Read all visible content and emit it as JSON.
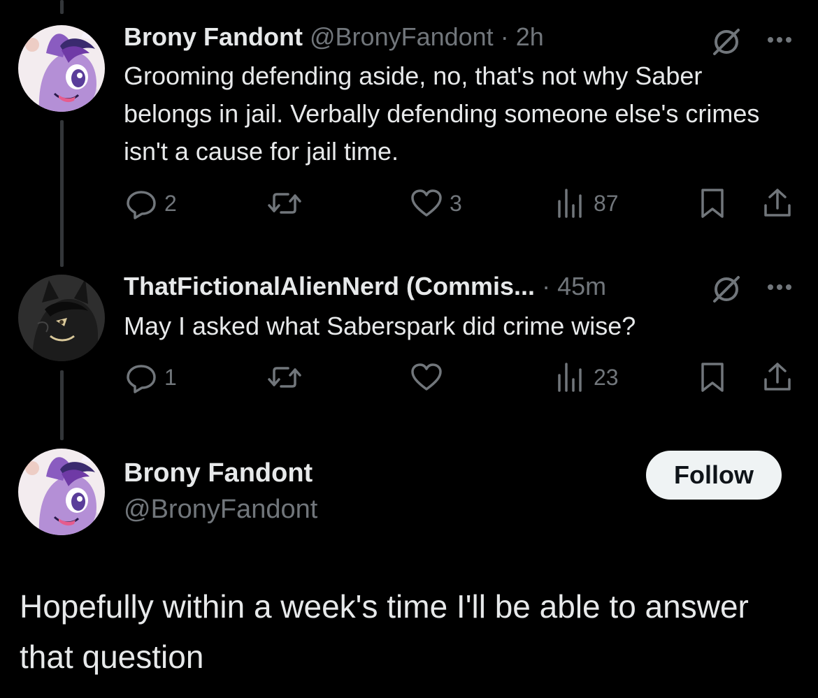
{
  "colors": {
    "background": "#000000",
    "text_primary": "#e7e9ea",
    "text_secondary": "#71767b",
    "thread_line": "#333639",
    "follow_button_bg": "#eff3f4",
    "follow_button_text": "#0f1419"
  },
  "reply1": {
    "author_name": "Brony Fandont",
    "author_handle": "@BronyFandont",
    "separator": "·",
    "time": "2h",
    "body": "Grooming defending aside, no, that's not why Saber belongs in jail. Verbally defending someone else's crimes isn't a cause for jail time.",
    "avatar_icon": "pony-avatar-icon",
    "actions": {
      "replies": "2",
      "reposts": "",
      "likes": "3",
      "views": "87"
    }
  },
  "reply2": {
    "author_name": "ThatFictionalAlienNerd (Commis...",
    "separator": "·",
    "time": "45m",
    "body": "May I asked what Saberspark did crime wise?",
    "avatar_icon": "dark-character-avatar-icon",
    "actions": {
      "replies": "1",
      "reposts": "",
      "likes": "",
      "views": "23"
    }
  },
  "main_post": {
    "author_name": "Brony Fandont",
    "author_handle": "@BronyFandont",
    "follow_label": "Follow",
    "body": "Hopefully within a week's time I'll be able to answer that question",
    "avatar_icon": "pony-avatar-icon"
  }
}
